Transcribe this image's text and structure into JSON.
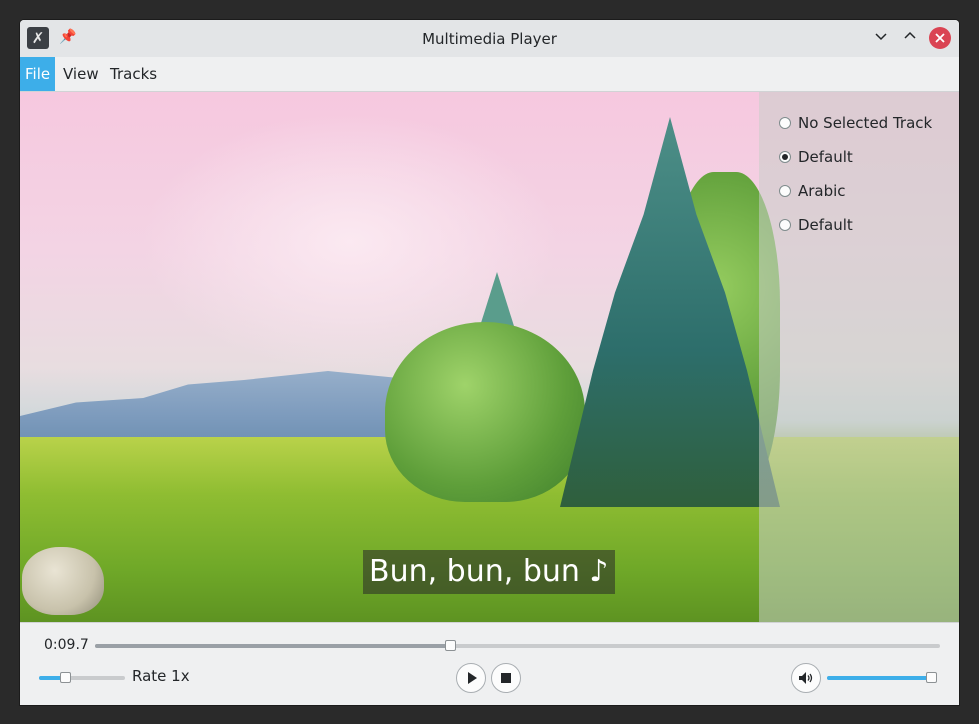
{
  "window": {
    "title": "Multimedia Player"
  },
  "icons": {
    "app": "app-icon",
    "pin": "pin-icon",
    "minimize": "chevron-down-icon",
    "maximize": "chevron-up-icon",
    "close": "close-icon",
    "play": "play-icon",
    "stop": "stop-icon",
    "volume": "volume-icon"
  },
  "menubar": {
    "items": [
      {
        "label": "File",
        "active": true
      },
      {
        "label": "View",
        "active": false
      },
      {
        "label": "Tracks",
        "active": false
      }
    ]
  },
  "tracks": {
    "options": [
      {
        "label": "No Selected Track",
        "checked": false
      },
      {
        "label": "Default",
        "checked": true
      },
      {
        "label": "Arabic",
        "checked": false
      },
      {
        "label": "Default",
        "checked": false
      }
    ]
  },
  "video": {
    "subtitle": "Bun, bun, bun ♪"
  },
  "controls": {
    "time": "0:09.7",
    "seek_fraction": 0.42,
    "rate_label": "Rate 1x",
    "rate_fraction": 0.3,
    "volume_fraction": 1.0
  },
  "colors": {
    "accent": "#3daee9",
    "close": "#da4453"
  }
}
